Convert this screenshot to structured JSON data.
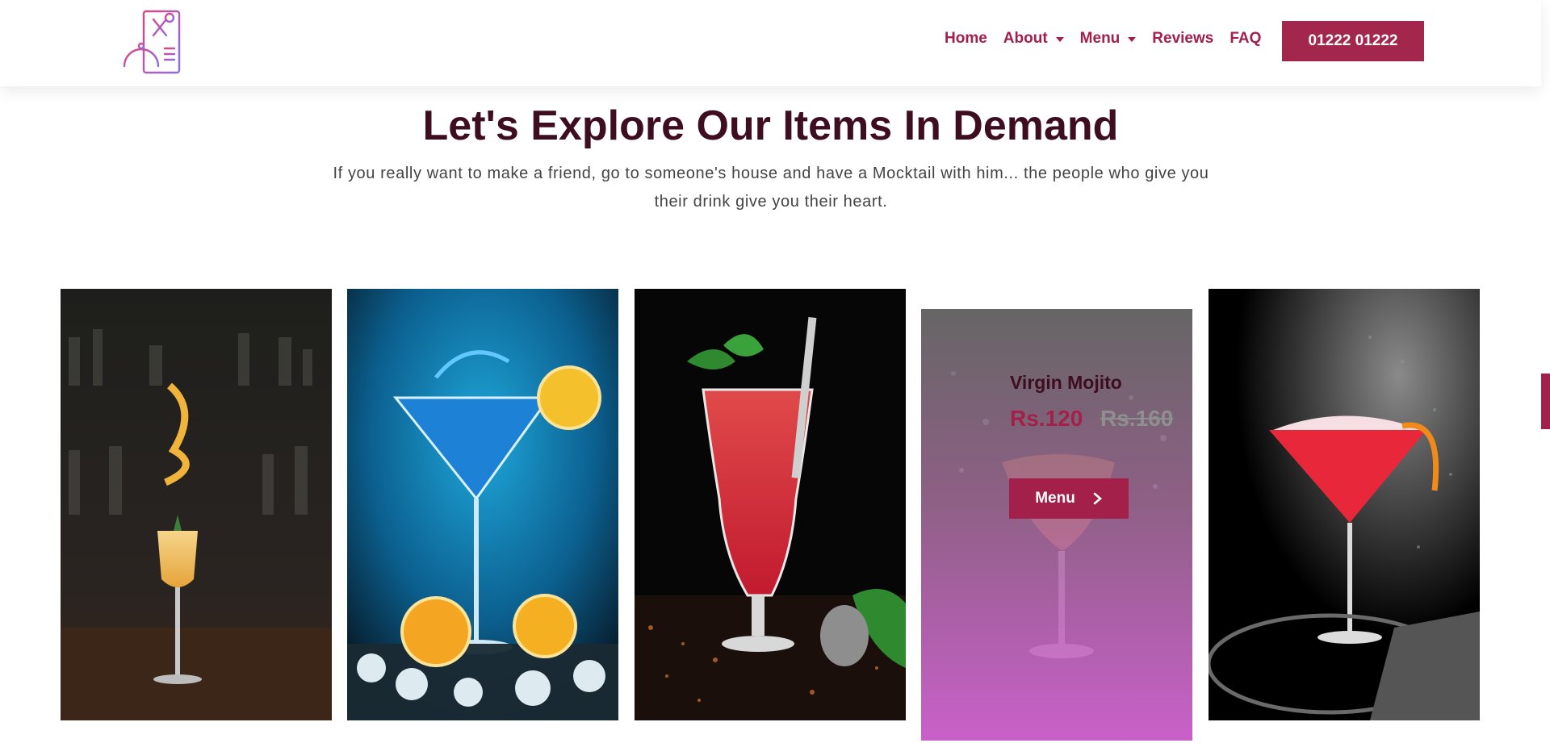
{
  "header": {
    "logo": {
      "icon": "restaurant-menu-icon",
      "colors": [
        "#e0457b",
        "#8a6cf0"
      ]
    },
    "nav": [
      {
        "label": "Home",
        "has_dropdown": false
      },
      {
        "label": "About",
        "has_dropdown": true
      },
      {
        "label": "Menu",
        "has_dropdown": true
      },
      {
        "label": "Reviews",
        "has_dropdown": false
      },
      {
        "label": "FAQ",
        "has_dropdown": false
      }
    ],
    "phone": "01222 01222"
  },
  "section": {
    "title": "Let's Explore Our Items In Demand",
    "subtitle": "If you really want to make a friend, go to someone's house and have a Mocktail with him... the people who give you their drink give you their heart."
  },
  "cards": [
    {
      "image": "garnished-cocktail-bar-image"
    },
    {
      "image": "blue-martini-image"
    },
    {
      "image": "red-hurricane-cocktail-image"
    },
    {
      "image": "orange-cocktail-splash-image",
      "name": "Virgin Mojito",
      "price": "Rs.120",
      "old_price": "Rs.160",
      "button": "Menu",
      "button_icon": "chevron-right-icon"
    },
    {
      "image": "red-frozen-cocktail-image"
    }
  ],
  "colors": {
    "accent": "#a3204a",
    "heading": "#3e0e20",
    "overlay_top": "#6e6e6e",
    "overlay_bottom": "#d764d7"
  }
}
